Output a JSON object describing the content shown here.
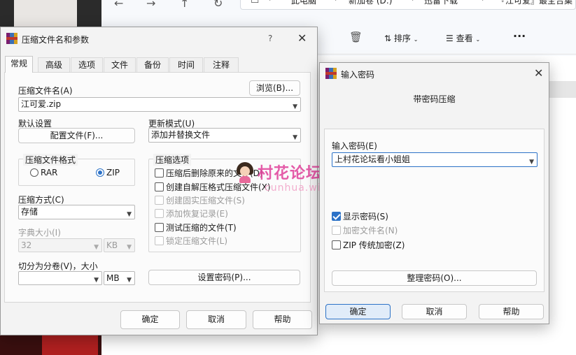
{
  "explorer": {
    "breadcrumbs": [
      "此电脑",
      "新加卷 (D:)",
      "迅雷下载",
      "『江可爱』最全合集"
    ],
    "commands": {
      "sort": "排序",
      "view": "查看"
    }
  },
  "archive_dialog": {
    "title": "压缩文件名和参数",
    "help_glyph": "?",
    "tabs": [
      "常规",
      "高级",
      "选项",
      "文件",
      "备份",
      "时间",
      "注释"
    ],
    "archive_name_label": "压缩文件名(A)",
    "browse_button": "浏览(B)...",
    "archive_name_value": "江可爱.zip",
    "default_settings_label": "默认设置",
    "profiles_button": "配置文件(F)...",
    "update_mode_label": "更新模式(U)",
    "update_mode_value": "添加并替换文件",
    "format_group_title": "压缩文件格式",
    "format_rar": "RAR",
    "format_zip": "ZIP",
    "method_label": "压缩方式(C)",
    "method_value": "存储",
    "dict_label": "字典大小(I)",
    "dict_value": "32",
    "dict_unit": "KB",
    "split_label": "切分为分卷(V)，大小",
    "split_value": "",
    "split_unit": "MB",
    "options_group_title": "压缩选项",
    "options": [
      {
        "label": "压缩后删除原来的文件(D)",
        "checked": false,
        "enabled": true
      },
      {
        "label": "创建自解压格式压缩文件(X)",
        "checked": false,
        "enabled": true
      },
      {
        "label": "创建固实压缩文件(S)",
        "checked": false,
        "enabled": false
      },
      {
        "label": "添加恢复记录(E)",
        "checked": false,
        "enabled": false
      },
      {
        "label": "测试压缩的文件(T)",
        "checked": false,
        "enabled": true
      },
      {
        "label": "锁定压缩文件(L)",
        "checked": false,
        "enabled": false
      }
    ],
    "set_password_button": "设置密码(P)...",
    "ok_button": "确定",
    "cancel_button": "取消",
    "help_button": "帮助"
  },
  "password_dialog": {
    "title": "输入密码",
    "heading": "带密码压缩",
    "password_label": "输入密码(E)",
    "password_value": "上村花论坛看小姐姐",
    "show_password": "显示密码(S)",
    "encrypt_names": "加密文件名(N)",
    "zip_legacy": "ZIP 传统加密(Z)",
    "organize_button": "整理密码(O)...",
    "ok_button": "确定",
    "cancel_button": "取消",
    "help_button": "帮助"
  },
  "watermark": {
    "text": "村花论坛",
    "url": "cunhua.win"
  }
}
